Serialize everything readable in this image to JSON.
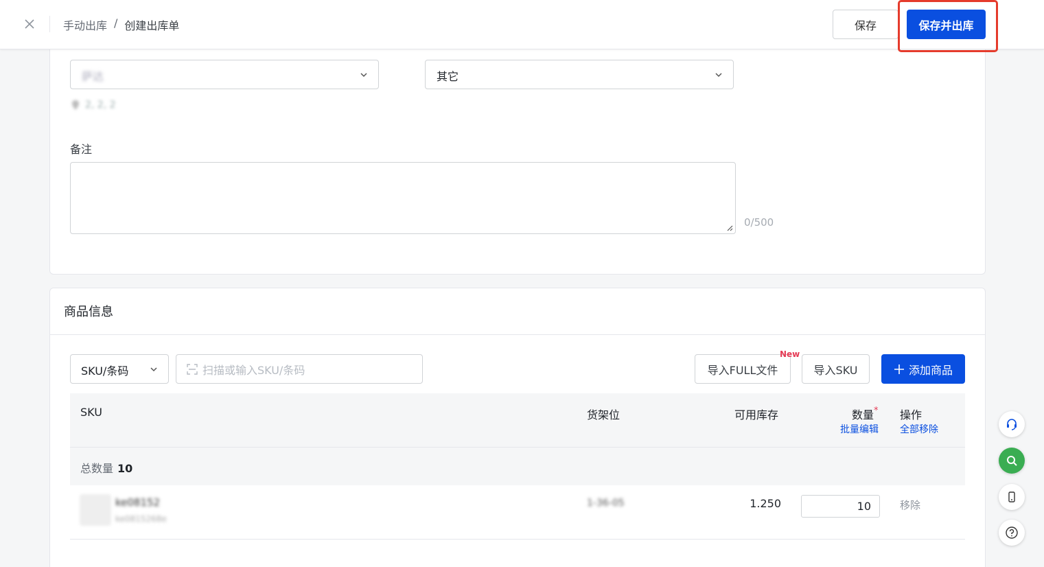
{
  "header": {
    "breadcrumb_root": "手动出库",
    "breadcrumb_sep": "/",
    "breadcrumb_current": "创建出库单",
    "save_label": "保存",
    "save_and_out_label": "保存并出库"
  },
  "form": {
    "warehouse_value": "萨达",
    "warehouse_address": "2, 2, 2",
    "type_value": "其它",
    "remark_label": "备注",
    "remark_counter": "0/500"
  },
  "goods": {
    "title": "商品信息",
    "search_type": "SKU/条码",
    "search_placeholder": "扫描或输入SKU/条码",
    "import_full_label": "导入FULL文件",
    "new_badge": "New",
    "import_sku_label": "导入SKU",
    "add_label": "添加商品",
    "columns": {
      "sku": "SKU",
      "shelf": "货架位",
      "available": "可用库存",
      "quantity": "数量",
      "quantity_star": "*",
      "batch_edit": "批量编辑",
      "actions": "操作",
      "remove_all": "全部移除"
    },
    "total_label": "总数量",
    "total_value": "10",
    "rows": [
      {
        "sku": "ke08152",
        "sku_sub": "ke0815268e",
        "shelf": "1-36-05",
        "available": "1.250",
        "quantity": "10",
        "action": "移除"
      }
    ]
  },
  "colors": {
    "primary": "#0a4fe0",
    "highlight_border": "#e53b2c",
    "accent_green": "#3aad52"
  }
}
